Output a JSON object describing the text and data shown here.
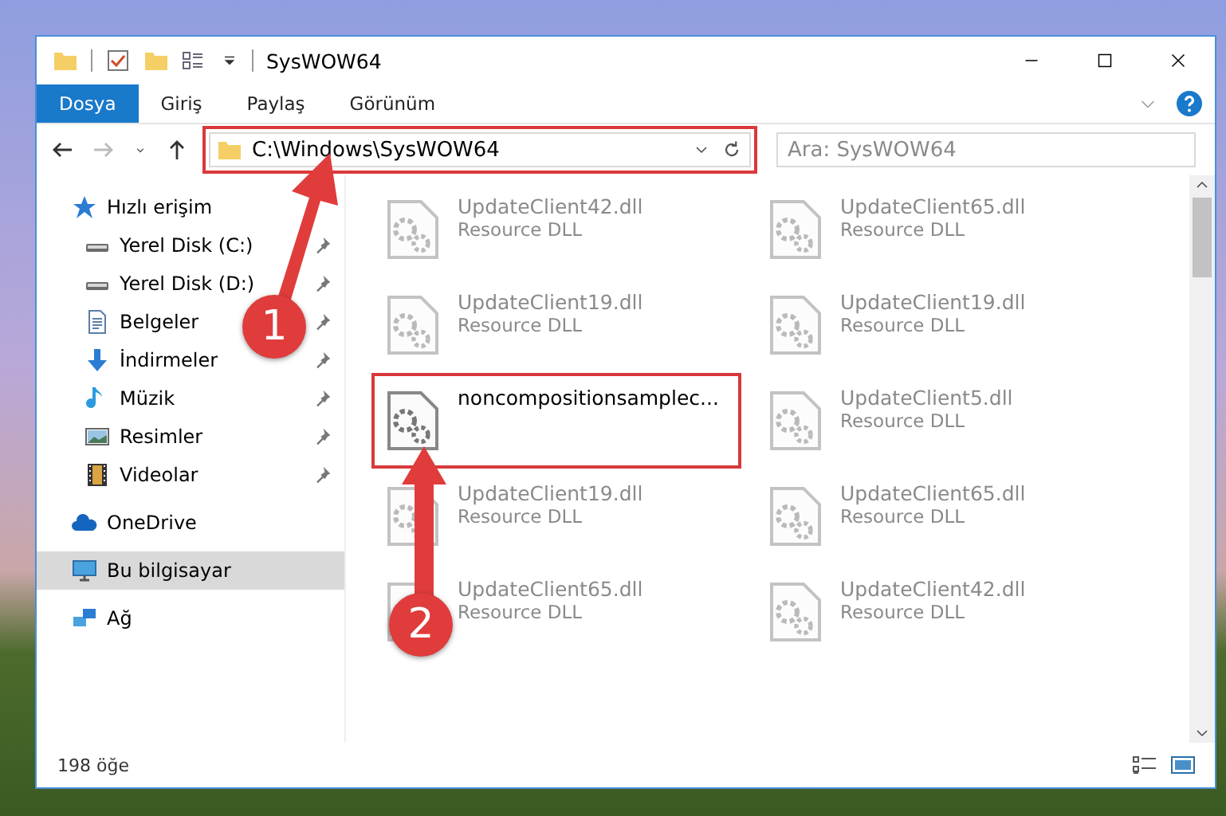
{
  "window": {
    "title": "SysWOW64"
  },
  "ribbon_tabs": [
    {
      "label": "Dosya",
      "selected": true
    },
    {
      "label": "Giriş",
      "selected": false
    },
    {
      "label": "Paylaş",
      "selected": false
    },
    {
      "label": "Görünüm",
      "selected": false
    }
  ],
  "address": {
    "path": "C:\\Windows\\SysWOW64",
    "highlighted": true
  },
  "search": {
    "placeholder": "Ara: SysWOW64"
  },
  "sidebar": {
    "items": [
      {
        "label": "Hızlı erişim",
        "kind": "star",
        "selected": false,
        "children": [
          {
            "label": "Yerel Disk (C:)",
            "kind": "drive",
            "pinned": true,
            "selected": false
          },
          {
            "label": "Yerel Disk (D:)",
            "kind": "drive",
            "pinned": true,
            "selected": false
          },
          {
            "label": "Belgeler",
            "kind": "document",
            "pinned": true,
            "selected": false
          },
          {
            "label": "İndirmeler",
            "kind": "download",
            "pinned": true,
            "selected": false
          },
          {
            "label": "Müzik",
            "kind": "music",
            "pinned": true,
            "selected": false
          },
          {
            "label": "Resimler",
            "kind": "picture",
            "pinned": true,
            "selected": false
          },
          {
            "label": "Videolar",
            "kind": "video",
            "pinned": true,
            "selected": false
          }
        ]
      },
      {
        "label": "OneDrive",
        "kind": "cloud",
        "selected": false
      },
      {
        "label": "Bu bilgisayar",
        "kind": "computer",
        "selected": true
      },
      {
        "label": "Ağ",
        "kind": "network",
        "selected": false
      }
    ]
  },
  "files": [
    {
      "name": "UpdateClient42.dll",
      "type": "Resource DLL",
      "highlighted": false
    },
    {
      "name": "UpdateClient65.dll",
      "type": "Resource DLL",
      "highlighted": false
    },
    {
      "name": "UpdateClient19.dll",
      "type": "Resource DLL",
      "highlighted": false
    },
    {
      "name": "UpdateClient19.dll",
      "type": "Resource DLL",
      "highlighted": false
    },
    {
      "name": "noncompositionsamplec...",
      "highlighted": true
    },
    {
      "name": "UpdateClient5.dll",
      "type": "Resource DLL",
      "highlighted": false
    },
    {
      "name": "UpdateClient19.dll",
      "type": "Resource DLL",
      "highlighted": false
    },
    {
      "name": "UpdateClient65.dll",
      "type": "Resource DLL",
      "highlighted": false
    },
    {
      "name": "UpdateClient65.dll",
      "type": "Resource DLL",
      "highlighted": false
    },
    {
      "name": "UpdateClient42.dll",
      "type": "Resource DLL",
      "highlighted": false
    }
  ],
  "status_bar": {
    "count": "198 öğe"
  },
  "callouts": [
    {
      "number": "1"
    },
    {
      "number": "2"
    }
  ]
}
